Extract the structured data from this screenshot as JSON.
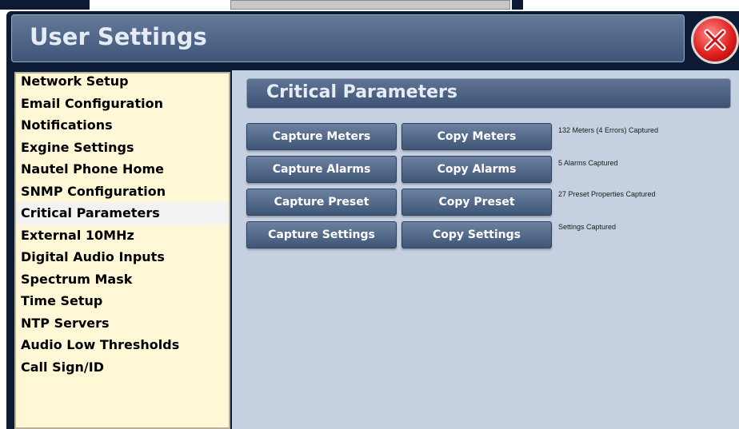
{
  "window": {
    "title": "User Settings",
    "close_icon": "close-x-icon"
  },
  "sidebar": {
    "items": [
      {
        "label": "Network Setup"
      },
      {
        "label": "Email Configuration"
      },
      {
        "label": "Notifications"
      },
      {
        "label": "Exgine Settings"
      },
      {
        "label": "Nautel Phone Home"
      },
      {
        "label": "SNMP Configuration"
      },
      {
        "label": "Critical Parameters",
        "selected": true
      },
      {
        "label": "External 10MHz"
      },
      {
        "label": "Digital Audio Inputs"
      },
      {
        "label": "Spectrum Mask"
      },
      {
        "label": "Time Setup"
      },
      {
        "label": "NTP Servers"
      },
      {
        "label": "Audio Low Thresholds"
      },
      {
        "label": "Call Sign/ID"
      }
    ]
  },
  "main": {
    "section_title": "Critical Parameters",
    "rows": [
      {
        "capture_label": "Capture Meters",
        "copy_label": "Copy Meters",
        "status": "132 Meters (4 Errors) Captured"
      },
      {
        "capture_label": "Capture Alarms",
        "copy_label": "Copy Alarms",
        "status": "5 Alarms Captured"
      },
      {
        "capture_label": "Capture Preset",
        "copy_label": "Copy Preset",
        "status": "27 Preset Properties Captured"
      },
      {
        "capture_label": "Capture Settings",
        "copy_label": "Copy Settings",
        "status": "Settings Captured"
      }
    ]
  },
  "colors": {
    "window_bg": "#0d1a33",
    "sidebar_bg": "#fff8d6",
    "content_bg": "#c5d0e0",
    "button": "#4a6080",
    "close": "#e02020"
  }
}
